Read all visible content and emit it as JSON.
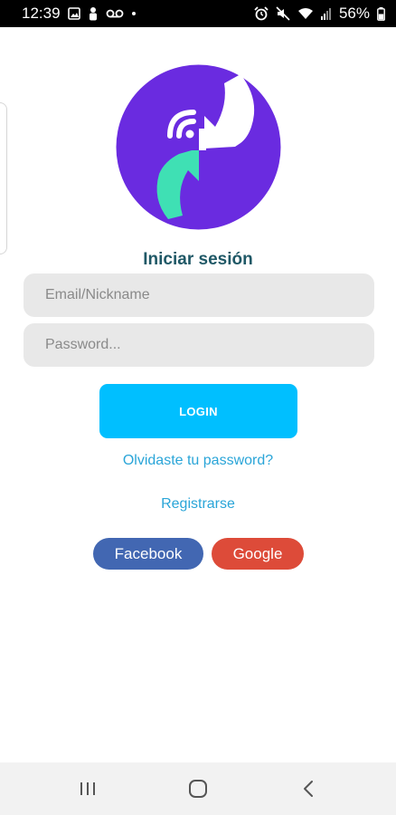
{
  "status_bar": {
    "time": "12:39",
    "battery": "56%",
    "left_icons": [
      "image-icon",
      "person-icon",
      "voicemail-icon",
      "dot-icon"
    ],
    "right_icons": [
      "alarm-icon",
      "mute-icon",
      "wifi-icon",
      "signal-icon",
      "battery-icon"
    ]
  },
  "login": {
    "title": "Iniciar sesión",
    "email_placeholder": "Email/Nickname",
    "password_placeholder": "Password...",
    "login_label": "LOGIN",
    "forgot_label": "Olvidaste tu password?",
    "register_label": "Registrarse",
    "facebook_label": "Facebook",
    "google_label": "Google"
  },
  "colors": {
    "logo_purple": "#6a2be0",
    "logo_teal": "#3fe0b4",
    "title": "#1f5866",
    "login_button": "#00bfff",
    "link": "#2aa5d8",
    "facebook": "#4267b2",
    "google": "#dd4b39"
  },
  "nav_bar": {
    "icons": [
      "recents-icon",
      "home-icon",
      "back-icon"
    ]
  }
}
